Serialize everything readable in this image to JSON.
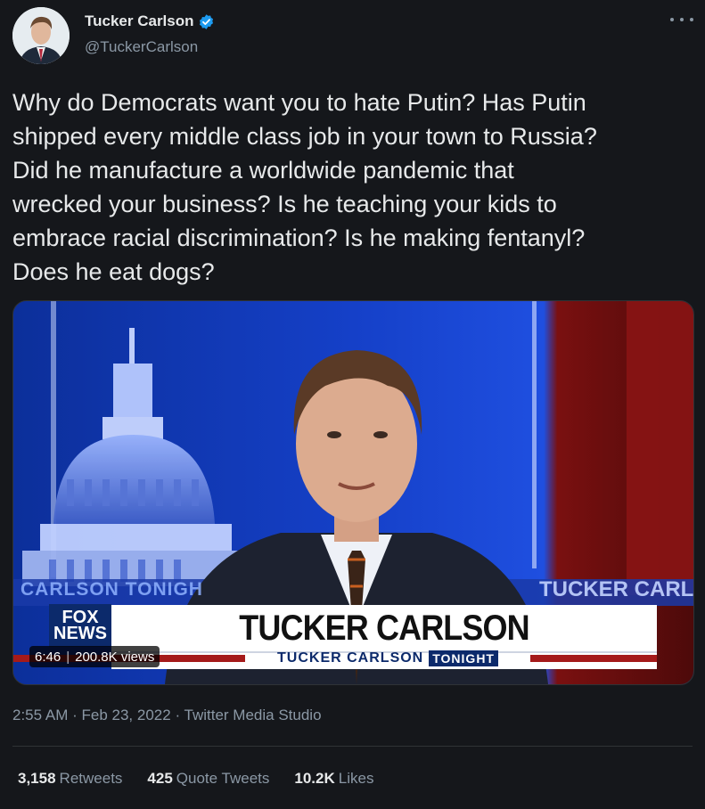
{
  "author": {
    "display_name": "Tucker Carlson",
    "handle": "@TuckerCarlson",
    "verified": true
  },
  "tweet": {
    "text": "Why do Democrats want you to hate Putin? Has Putin\nshipped every middle class job in your town to Russia?\nDid he manufacture a worldwide pandemic that\nwrecked your business? Is he teaching your kids to\nembrace racial discrimination? Is he making fentanyl?\nDoes he eat dogs?"
  },
  "media": {
    "chyron_main": "TUCKER CARLSON",
    "chyron_sub": "TUCKER CARLSON",
    "chyron_tonight": "TONIGHT",
    "left_wall_text": "CARLSON TONIGH",
    "right_wall_text": "TUCKER CARLS(",
    "logo_top": "FOX",
    "logo_bottom": "NEWS",
    "duration": "6:46",
    "views": "200.8K views"
  },
  "meta": {
    "time": "2:55 AM",
    "date": "Feb 23, 2022",
    "source": "Twitter Media Studio"
  },
  "stats": {
    "retweets_count": "3,158",
    "retweets_label": "Retweets",
    "quotes_count": "425",
    "quotes_label": "Quote Tweets",
    "likes_count": "10.2K",
    "likes_label": "Likes"
  },
  "colors": {
    "background": "#15171b",
    "text": "#e7e9ea",
    "secondary": "#8b98a5",
    "verified": "#1d9bf0"
  }
}
